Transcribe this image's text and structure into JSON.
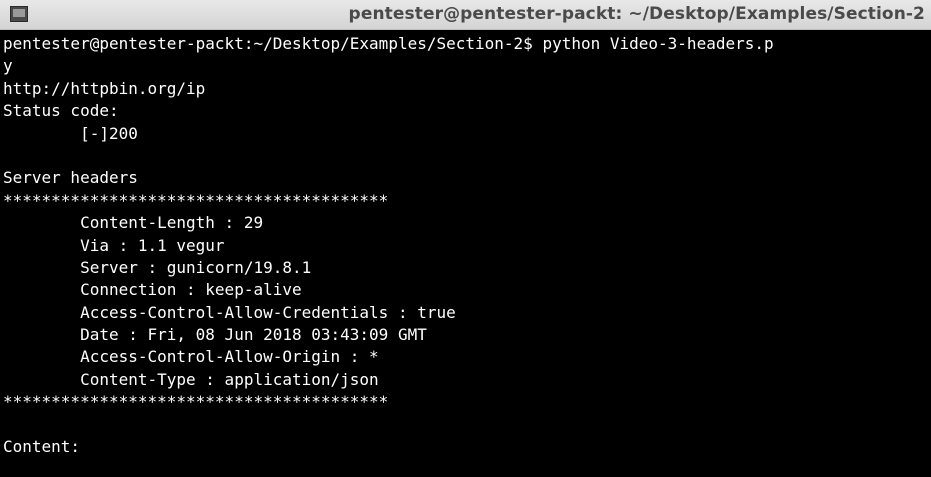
{
  "window": {
    "title": "pentester@pentester-packt: ~/Desktop/Examples/Section-2"
  },
  "terminal": {
    "lines": [
      "pentester@pentester-packt:~/Desktop/Examples/Section-2$ python Video-3-headers.p",
      "y",
      "http://httpbin.org/ip",
      "Status code:",
      "        [-]200",
      "",
      "Server headers",
      "****************************************",
      "        Content-Length : 29",
      "        Via : 1.1 vegur",
      "        Server : gunicorn/19.8.1",
      "        Connection : keep-alive",
      "        Access-Control-Allow-Credentials : true",
      "        Date : Fri, 08 Jun 2018 03:43:09 GMT",
      "        Access-Control-Allow-Origin : *",
      "        Content-Type : application/json",
      "****************************************",
      "",
      "Content:"
    ]
  }
}
